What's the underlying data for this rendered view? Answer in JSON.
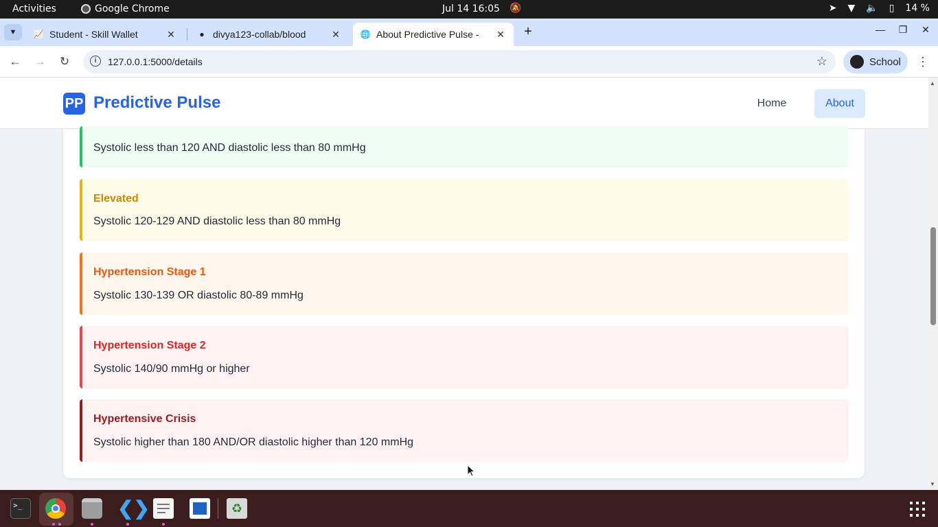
{
  "system_bar": {
    "activities": "Activities",
    "app_name": "Google Chrome",
    "datetime": "Jul 14  16:05",
    "battery": "14 %"
  },
  "browser": {
    "tabs": [
      {
        "title": "Student - Skill Wallet",
        "active": false
      },
      {
        "title": "divya123-collab/blood",
        "active": false
      },
      {
        "title": "About Predictive Pulse -",
        "active": true
      }
    ],
    "url": "127.0.0.1:5000/details",
    "profile": "School"
  },
  "site": {
    "logo_text": "PP",
    "brand": "Predictive Pulse",
    "nav": {
      "home": "Home",
      "about": "About"
    }
  },
  "categories": [
    {
      "name": "",
      "description": "Systolic less than 120 AND diastolic less than 80 mmHg",
      "bg": "#f0fdf4",
      "border": "#22c55e",
      "title_color": "#15803d"
    },
    {
      "name": "Elevated",
      "description": "Systolic 120-129 AND diastolic less than 80 mmHg",
      "bg": "#fefce8",
      "border": "#eab308",
      "title_color": "#ca8a04"
    },
    {
      "name": "Hypertension Stage 1",
      "description": "Systolic 130-139 OR diastolic 80-89 mmHg",
      "bg": "#fff7ed",
      "border": "#f97316",
      "title_color": "#ea580c"
    },
    {
      "name": "Hypertension Stage 2",
      "description": "Systolic 140/90 mmHg or higher",
      "bg": "#fef2f2",
      "border": "#ef4444",
      "title_color": "#dc2626"
    },
    {
      "name": "Hypertensive Crisis",
      "description": "Systolic higher than 180 AND/OR diastolic higher than 120 mmHg",
      "bg": "#fef2f2",
      "border": "#991b1b",
      "title_color": "#991b1b"
    }
  ]
}
